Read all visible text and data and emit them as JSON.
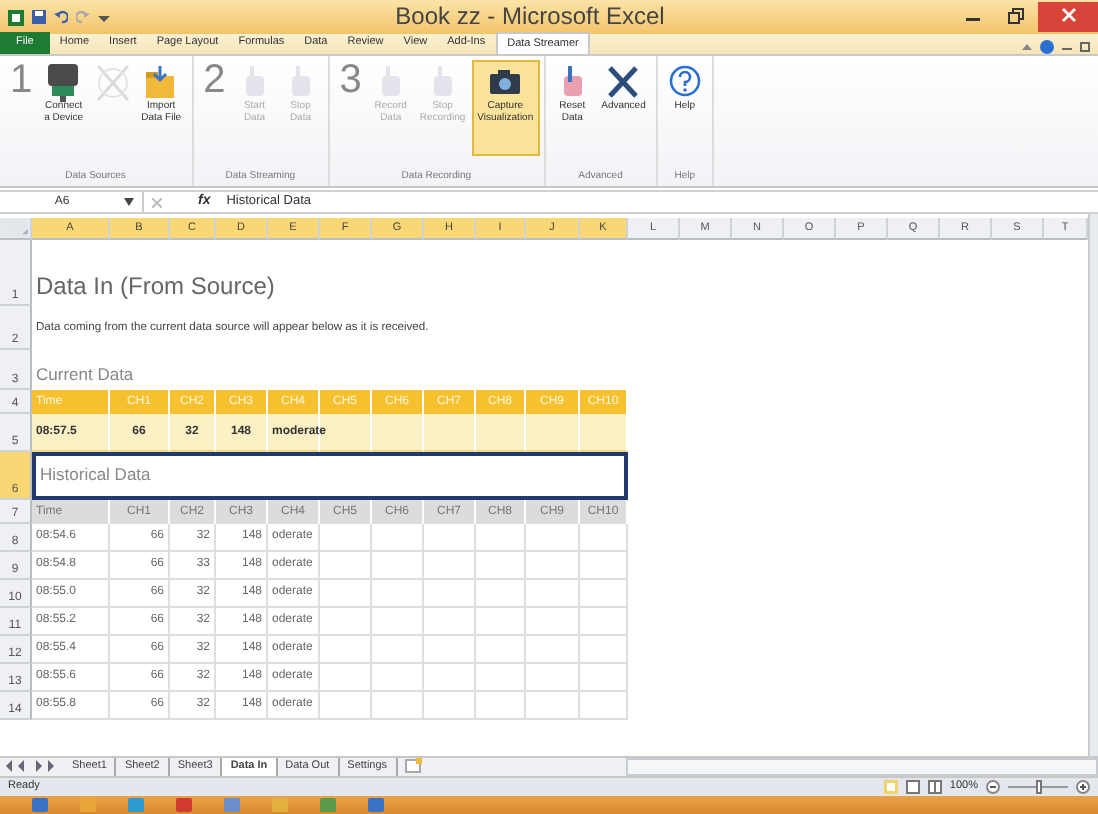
{
  "window": {
    "title": "Book zz - Microsoft Excel"
  },
  "tabs": [
    {
      "label": "File",
      "kind": "file",
      "selected": false
    },
    {
      "label": "Home",
      "kind": "tab",
      "selected": false
    },
    {
      "label": "Insert",
      "kind": "tab",
      "selected": false
    },
    {
      "label": "Page Layout",
      "kind": "tab",
      "selected": false
    },
    {
      "label": "Formulas",
      "kind": "tab",
      "selected": false
    },
    {
      "label": "Data",
      "kind": "tab",
      "selected": false
    },
    {
      "label": "Review",
      "kind": "tab",
      "selected": false
    },
    {
      "label": "View",
      "kind": "tab",
      "selected": false
    },
    {
      "label": "Add-Ins",
      "kind": "tab",
      "selected": false
    },
    {
      "label": "Data Streamer",
      "kind": "tab",
      "selected": true
    }
  ],
  "ribbon_groups": [
    {
      "label": "Data Sources",
      "step": "1",
      "buttons": [
        {
          "label": "Connect\na Device",
          "disabled": false,
          "highlighted": false
        },
        {
          "disabled": true,
          "highlighted": false
        },
        {
          "label": "Import\nData File",
          "disabled": false,
          "highlighted": false
        }
      ]
    },
    {
      "label": "Data Streaming",
      "step": "2",
      "buttons": [
        {
          "label": "Start\nData",
          "disabled": true,
          "highlighted": false
        },
        {
          "label": "Stop\nData",
          "disabled": true,
          "highlighted": false
        }
      ]
    },
    {
      "label": "Data Recording",
      "step": "3",
      "buttons": [
        {
          "label": "Record\nData",
          "disabled": true,
          "highlighted": false
        },
        {
          "label": "Stop\nRecording",
          "disabled": true,
          "highlighted": false
        },
        {
          "label": "Capture\nVisualization",
          "disabled": false,
          "highlighted": true
        }
      ]
    },
    {
      "label": "Advanced",
      "buttons": [
        {
          "label": "Reset\nData",
          "disabled": false,
          "highlighted": false
        },
        {
          "label": "Advanced",
          "disabled": false,
          "highlighted": false
        }
      ]
    },
    {
      "label": "Help",
      "buttons": [
        {
          "label": "Help",
          "disabled": false,
          "highlighted": false
        }
      ]
    }
  ],
  "formula_bar": {
    "name_box": "A6",
    "function_label": "fx",
    "formula": "Historical Data"
  },
  "columns": [
    {
      "label": "A",
      "selected": true
    },
    {
      "label": "B",
      "selected": true
    },
    {
      "label": "C",
      "selected": true
    },
    {
      "label": "D",
      "selected": true
    },
    {
      "label": "E",
      "selected": true
    },
    {
      "label": "F",
      "selected": true
    },
    {
      "label": "G",
      "selected": true
    },
    {
      "label": "H",
      "selected": true
    },
    {
      "label": "I",
      "selected": true
    },
    {
      "label": "J",
      "selected": true
    },
    {
      "label": "K",
      "selected": true
    },
    {
      "label": "L",
      "selected": false
    },
    {
      "label": "M",
      "selected": false
    },
    {
      "label": "N",
      "selected": false
    },
    {
      "label": "O",
      "selected": false
    },
    {
      "label": "P",
      "selected": false
    },
    {
      "label": "Q",
      "selected": false
    },
    {
      "label": "R",
      "selected": false
    },
    {
      "label": "S",
      "selected": false
    },
    {
      "label": "T",
      "selected": false
    }
  ],
  "rows": [
    {
      "number": "1",
      "kind": "title",
      "text": "Data In (From Source)"
    },
    {
      "number": "2",
      "kind": "note",
      "text": "Data coming from the current data source will appear below as it is received."
    },
    {
      "number": "3",
      "kind": "heading",
      "text": "Current Data",
      "selected": false
    },
    {
      "number": "4",
      "kind": "current-header",
      "cells": [
        "Time",
        "CH1",
        "CH2",
        "CH3",
        "CH4",
        "CH5",
        "CH6",
        "CH7",
        "CH8",
        "CH9",
        "CH10"
      ]
    },
    {
      "number": "5",
      "kind": "current-values",
      "cells": [
        "08:57.5",
        "66",
        "32",
        "148",
        "moderate"
      ]
    },
    {
      "number": "6",
      "kind": "heading",
      "text": "Historical Data",
      "selected": true
    },
    {
      "number": "7",
      "kind": "history-header",
      "cells": [
        "Time",
        "CH1",
        "CH2",
        "CH3",
        "CH4",
        "CH5",
        "CH6",
        "CH7",
        "CH8",
        "CH9",
        "CH10"
      ]
    },
    {
      "number": "8",
      "kind": "history-values",
      "cells": [
        "08:54.6",
        "66",
        "32",
        "148",
        "oderate"
      ]
    },
    {
      "number": "9",
      "kind": "history-values",
      "cells": [
        "08:54.8",
        "66",
        "33",
        "148",
        "oderate"
      ]
    },
    {
      "number": "10",
      "kind": "history-values",
      "cells": [
        "08:55.0",
        "66",
        "32",
        "148",
        "oderate"
      ]
    },
    {
      "number": "11",
      "kind": "history-values",
      "cells": [
        "08:55.2",
        "66",
        "32",
        "148",
        "oderate"
      ]
    },
    {
      "number": "12",
      "kind": "history-values",
      "cells": [
        "08:55.4",
        "66",
        "32",
        "148",
        "oderate"
      ]
    },
    {
      "number": "13",
      "kind": "history-values",
      "cells": [
        "08:55.6",
        "66",
        "32",
        "148",
        "oderate"
      ]
    },
    {
      "number": "14",
      "kind": "history-values",
      "cells": [
        "08:55.8",
        "66",
        "32",
        "148",
        "oderate"
      ]
    }
  ],
  "sheet_tabs": [
    {
      "label": "Sheet1",
      "selected": false
    },
    {
      "label": "Sheet2",
      "selected": false
    },
    {
      "label": "Sheet3",
      "selected": false
    },
    {
      "label": "Data In",
      "selected": true
    },
    {
      "label": "Data Out",
      "selected": false
    },
    {
      "label": "Settings",
      "selected": false
    }
  ],
  "status_bar": {
    "status": "Ready",
    "zoom": {
      "reading": "100%",
      "level": 0.5
    }
  }
}
